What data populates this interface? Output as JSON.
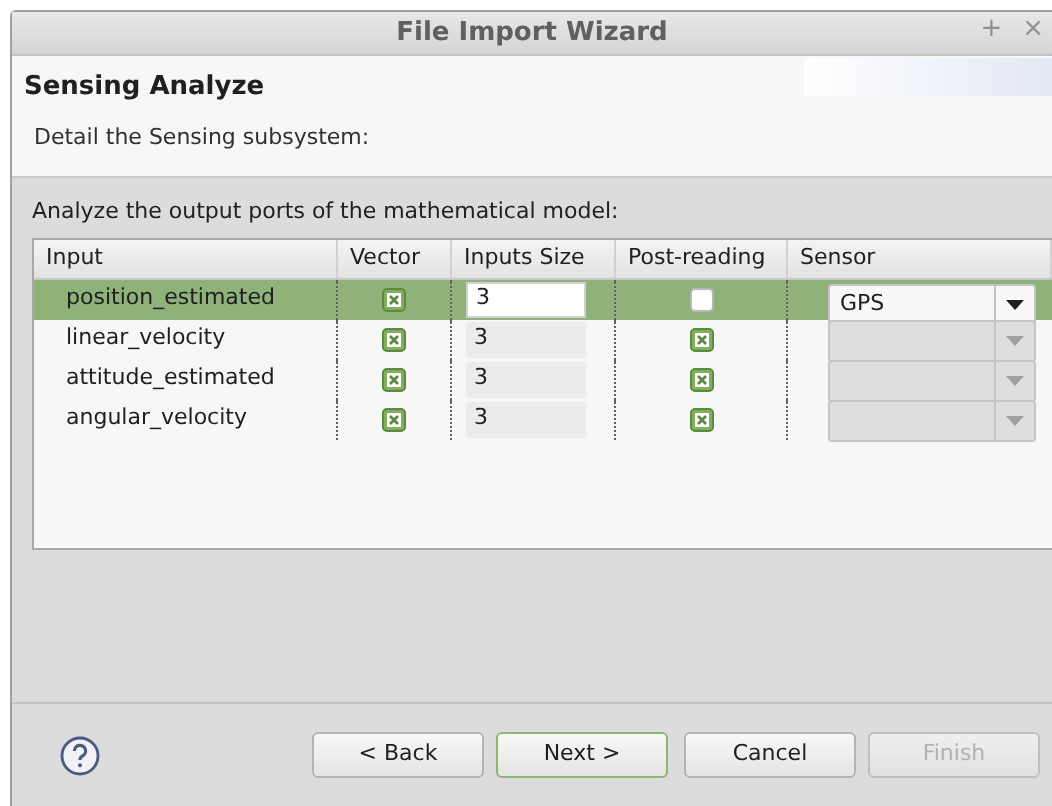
{
  "window": {
    "title": "File Import Wizard",
    "controls": [
      "+",
      "×"
    ]
  },
  "header": {
    "title": "Sensing Analyze",
    "description": "Detail the Sensing subsystem:"
  },
  "prompt": "Analyze the output ports of the mathematical model:",
  "table": {
    "columns": [
      "Input",
      "Vector",
      "Inputs Size",
      "Post-reading",
      "Sensor"
    ],
    "rows": [
      {
        "input": "position_estimated",
        "selected": true,
        "vector": true,
        "size": "3",
        "post_reading": false,
        "sensor": {
          "value": "GPS",
          "disabled": false
        }
      },
      {
        "input": "linear_velocity",
        "selected": false,
        "vector": true,
        "size": "3",
        "post_reading": true,
        "sensor": {
          "disabled": true
        }
      },
      {
        "input": "attitude_estimated",
        "selected": false,
        "vector": true,
        "size": "3",
        "post_reading": true,
        "sensor": {
          "disabled": true
        }
      },
      {
        "input": "angular_velocity",
        "selected": false,
        "vector": true,
        "size": "3",
        "post_reading": true,
        "sensor": {
          "disabled": true
        }
      }
    ]
  },
  "buttons": [
    {
      "label": "< Back",
      "default": false,
      "disabled": false
    },
    {
      "label": "Next >",
      "default": true,
      "disabled": false
    },
    {
      "label": "Cancel",
      "default": false,
      "disabled": false
    },
    {
      "label": "Finish",
      "default": false,
      "disabled": true
    }
  ]
}
